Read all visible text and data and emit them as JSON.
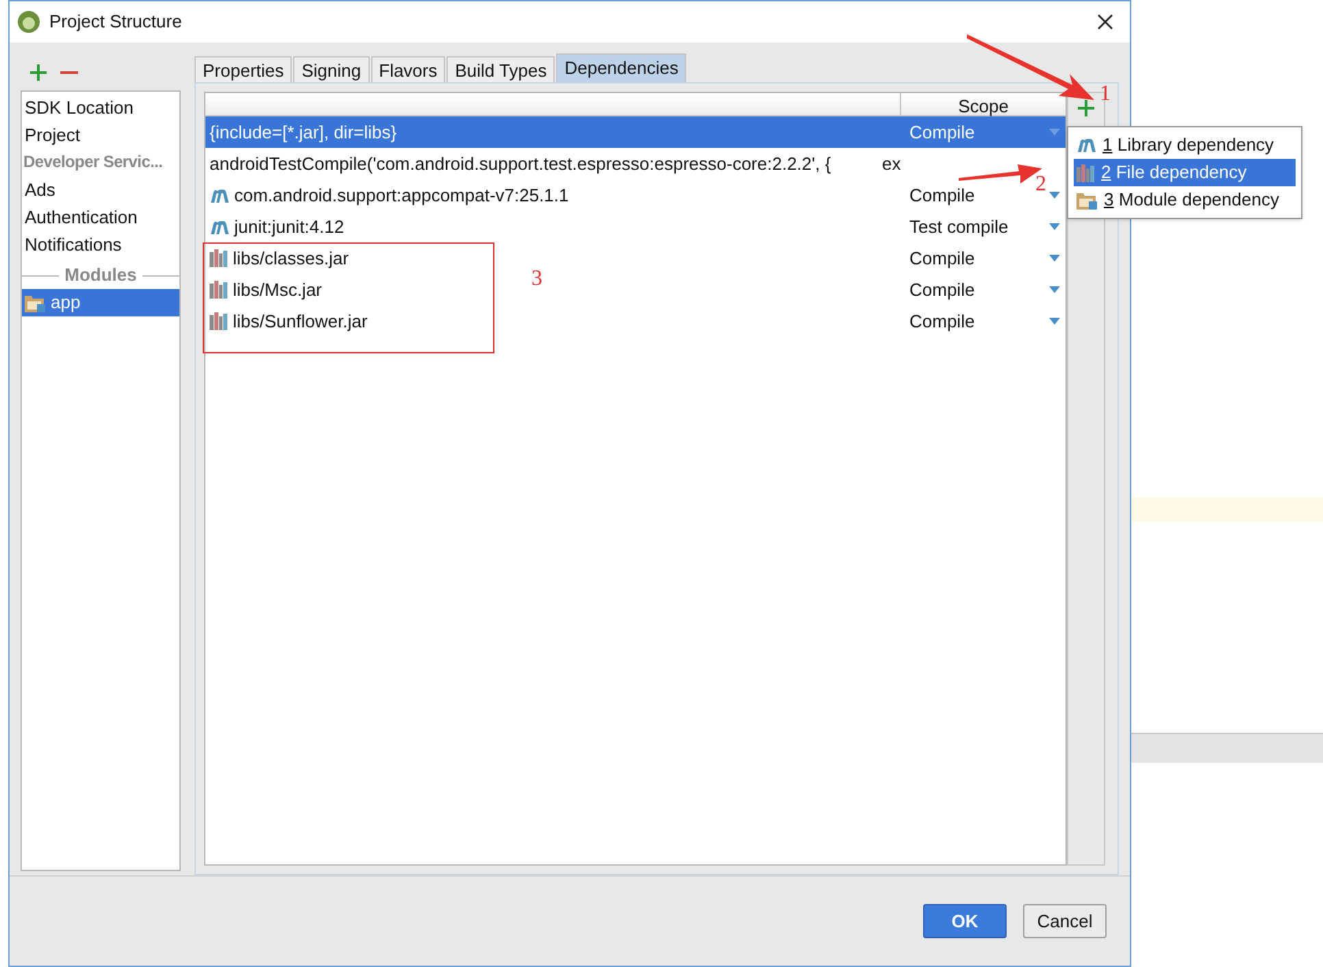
{
  "window": {
    "title": "Project Structure"
  },
  "sidebar": {
    "items": [
      {
        "label": "SDK Location",
        "kind": "item",
        "selected": false
      },
      {
        "label": "Project",
        "kind": "item",
        "selected": false
      },
      {
        "label": "Developer Servic...",
        "kind": "header",
        "selected": false
      },
      {
        "label": "Ads",
        "kind": "item",
        "selected": false
      },
      {
        "label": "Authentication",
        "kind": "item",
        "selected": false
      },
      {
        "label": "Notifications",
        "kind": "item",
        "selected": false
      },
      {
        "label": "Modules",
        "kind": "separator",
        "selected": false
      },
      {
        "label": "app",
        "kind": "module",
        "selected": true
      }
    ]
  },
  "tabs": [
    {
      "label": "Properties",
      "selected": false
    },
    {
      "label": "Signing",
      "selected": false
    },
    {
      "label": "Flavors",
      "selected": false
    },
    {
      "label": "Build Types",
      "selected": false
    },
    {
      "label": "Dependencies",
      "selected": true
    }
  ],
  "table": {
    "columns": [
      "Scope"
    ],
    "rows": [
      {
        "kind": "plain",
        "name": "{include=[*.jar], dir=libs}",
        "scope": "Compile",
        "selected": true
      },
      {
        "kind": "plain",
        "name": "androidTestCompile('com.android.support.test.espresso:espresso-core:2.2.2', {",
        "extra": "ex",
        "selected": false
      },
      {
        "kind": "maven",
        "name": "com.android.support:appcompat-v7:25.1.1",
        "scope": "Compile",
        "selected": false
      },
      {
        "kind": "maven",
        "name": "junit:junit:4.12",
        "scope": "Test compile",
        "selected": false
      },
      {
        "kind": "jar",
        "name": "libs/classes.jar",
        "scope": "Compile",
        "selected": false
      },
      {
        "kind": "jar",
        "name": "libs/Msc.jar",
        "scope": "Compile",
        "selected": false
      },
      {
        "kind": "jar",
        "name": "libs/Sunflower.jar",
        "scope": "Compile",
        "selected": false
      }
    ]
  },
  "popup_menu": {
    "items": [
      {
        "kind": "maven",
        "number": "1",
        "label": "Library dependency",
        "selected": false
      },
      {
        "kind": "jar",
        "number": "2",
        "label": "File dependency",
        "selected": true
      },
      {
        "kind": "module",
        "number": "3",
        "label": "Module dependency",
        "selected": false
      }
    ]
  },
  "annotations": [
    "1",
    "2",
    "3"
  ],
  "buttons": [
    {
      "label": "OK",
      "kind": "primary"
    },
    {
      "label": "Cancel",
      "kind": "secondary"
    }
  ]
}
